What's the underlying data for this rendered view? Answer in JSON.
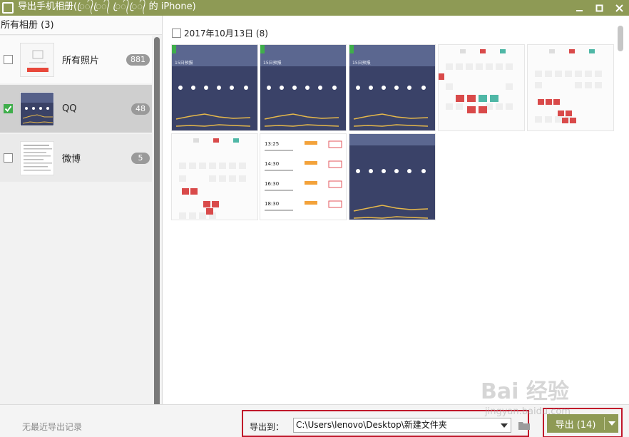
{
  "window": {
    "title": "导出手机相册(ꦿ᭄ꦿ᭄ ꦿ᭄ꦿ᭄ 的 iPhone)",
    "colors": {
      "titlebar": "#8e9a55",
      "accent_red": "#c0162a",
      "check_green": "#3fae4b"
    }
  },
  "sidebar": {
    "header": "所有相册 (3)",
    "albums": [
      {
        "name": "所有照片",
        "count": "881",
        "checked": false
      },
      {
        "name": "QQ",
        "count": "48",
        "checked": true
      },
      {
        "name": "微博",
        "count": "5",
        "checked": false
      }
    ]
  },
  "main": {
    "group_label": "2017年10月13日 (8)",
    "photos": [
      {
        "kind": "weather",
        "header": "15日预报"
      },
      {
        "kind": "weather",
        "header": "15日预报"
      },
      {
        "kind": "weather",
        "header": "15日预报"
      },
      {
        "kind": "seats"
      },
      {
        "kind": "seats"
      },
      {
        "kind": "seats"
      },
      {
        "kind": "schedule",
        "times": [
          "13:25",
          "14:30",
          "16:30",
          "18:30"
        ]
      },
      {
        "kind": "weather",
        "header": ""
      }
    ]
  },
  "bottom": {
    "recent": "无最近导出记录",
    "export_to_label": "导出到：",
    "path": "C:\\Users\\lenovo\\Desktop\\新建文件夹",
    "export_button": "导出 (14)"
  },
  "watermark": {
    "text": "Bai 经验",
    "sub": "jingyan.baidu.com"
  }
}
